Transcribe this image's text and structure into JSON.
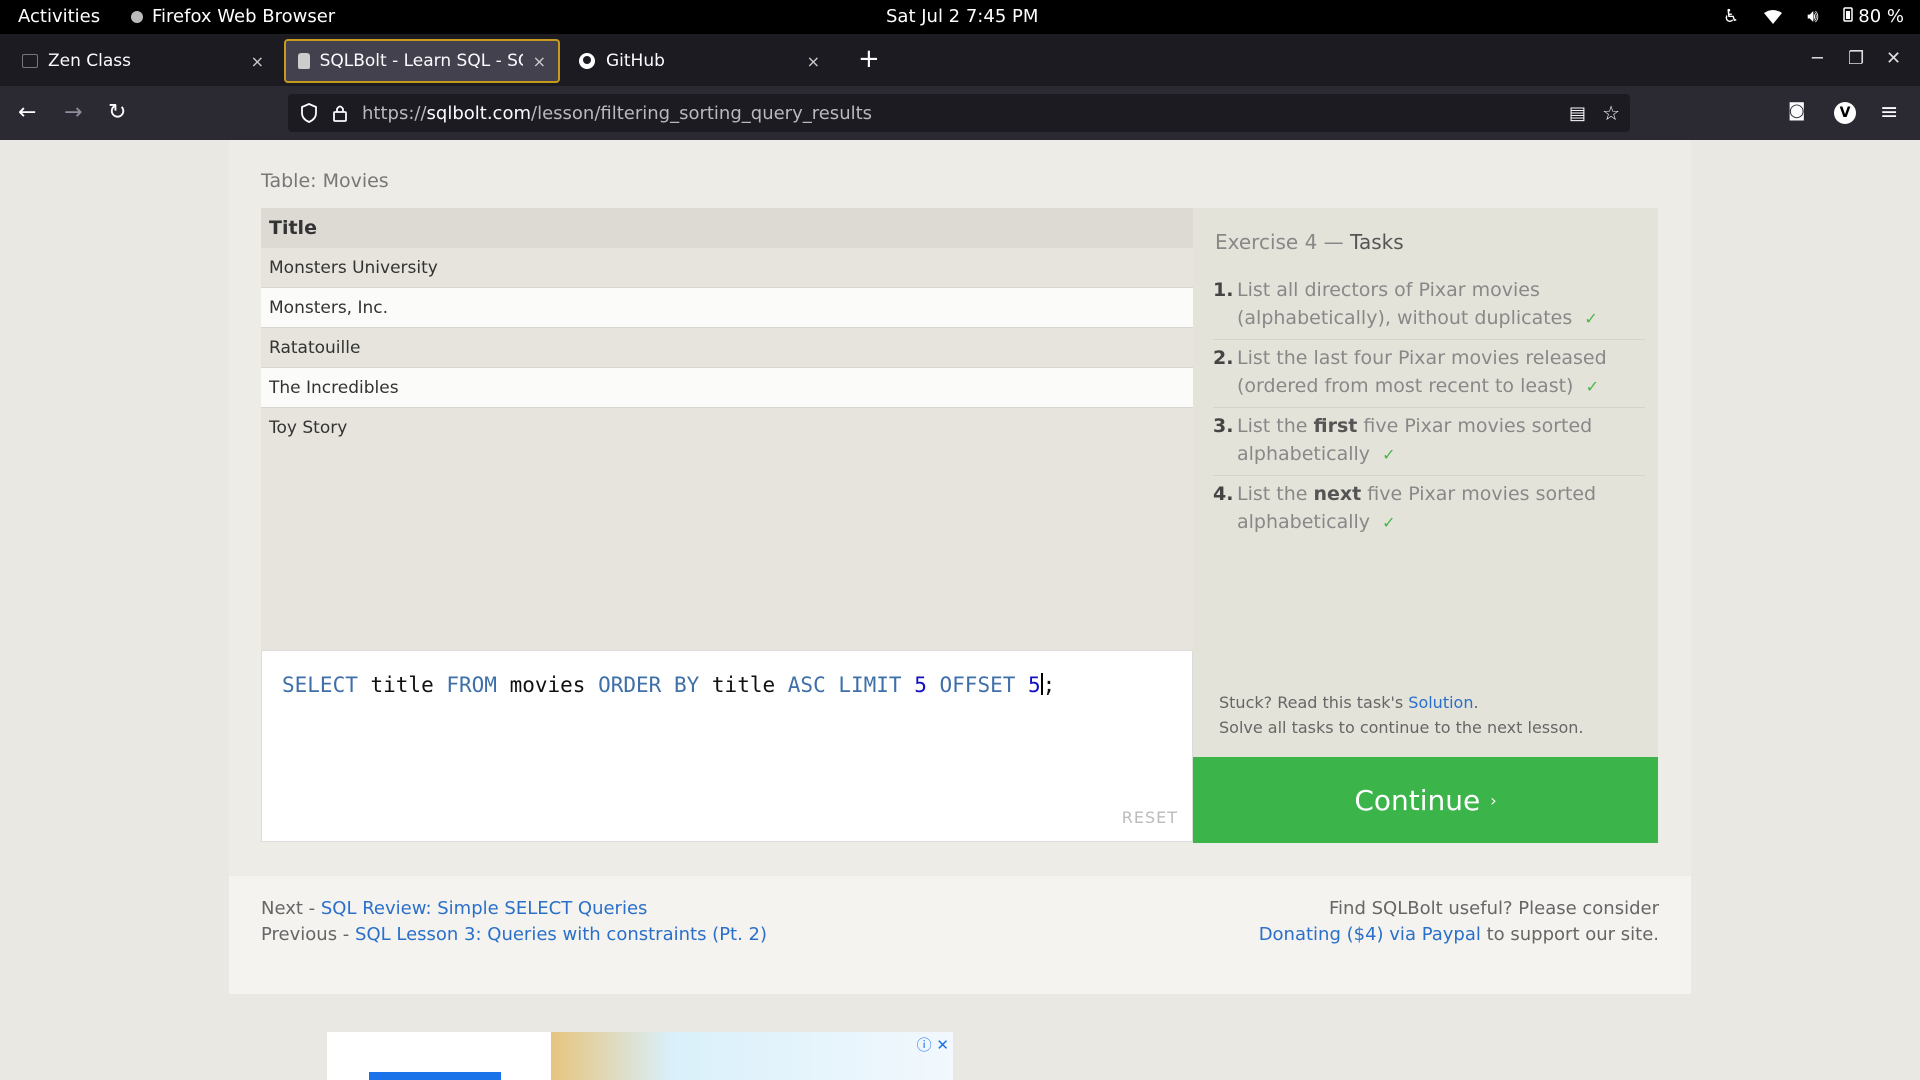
{
  "system": {
    "activities": "Activities",
    "app_name": "Firefox Web Browser",
    "clock": "Sat Jul 2  7:45 PM",
    "battery": "80 %"
  },
  "tabs": [
    {
      "label": "Zen Class",
      "close": "×"
    },
    {
      "label": "SQLBolt - Learn SQL - SQ",
      "close": "×"
    },
    {
      "label": "GitHub",
      "close": "×"
    }
  ],
  "new_tab": "+",
  "nav": {
    "url_scheme": "https://",
    "url_host": "sqlbolt.com",
    "url_path": "/lesson/filtering_sorting_query_results"
  },
  "page": {
    "table_caption": "Table: Movies",
    "column_header": "Title",
    "rows": [
      "Monsters University",
      "Monsters, Inc.",
      "Ratatouille",
      "The Incredibles",
      "Toy Story"
    ],
    "query": {
      "t1": "SELECT",
      "t2": " title ",
      "t3": "FROM",
      "t4": " movies ",
      "t5": "ORDER BY",
      "t6": " title ",
      "t7": "ASC LIMIT",
      "t8": " 5 ",
      "t9": "OFFSET",
      "t10": " 5",
      "t11": ";"
    },
    "reset": "RESET",
    "exercise_label": "Exercise 4 — ",
    "tasks_label": "Tasks",
    "tasks": [
      {
        "num": "1.",
        "pre": "List all directors of Pixar movies (alphabetically), without duplicates",
        "strong": "",
        "post": "",
        "check": "✓"
      },
      {
        "num": "2.",
        "pre": "List the last four Pixar movies released (ordered from most recent to least)",
        "strong": "",
        "post": "",
        "check": "✓"
      },
      {
        "num": "3.",
        "pre": "List the ",
        "strong": "first",
        "post": " five Pixar movies sorted alphabetically",
        "check": "✓"
      },
      {
        "num": "4.",
        "pre": "List the ",
        "strong": "next",
        "post": " five Pixar movies sorted alphabetically",
        "check": "✓"
      }
    ],
    "help_line1_pre": "Stuck? Read this task's ",
    "help_link": "Solution",
    "help_line1_post": ".",
    "help_line2": "Solve all tasks to continue to the next lesson.",
    "continue": "Continue",
    "continue_chev": "›",
    "next_label": "Next - ",
    "next_link": "SQL Review: Simple SELECT Queries",
    "prev_label": "Previous - ",
    "prev_link": "SQL Lesson 3: Queries with constraints (Pt. 2)",
    "donate_line1": "Find SQLBolt useful? Please consider",
    "donate_link": "Donating ($4) via Paypal",
    "donate_post": " to support our site."
  },
  "ad": {
    "controls": "ⓘ ✕"
  }
}
